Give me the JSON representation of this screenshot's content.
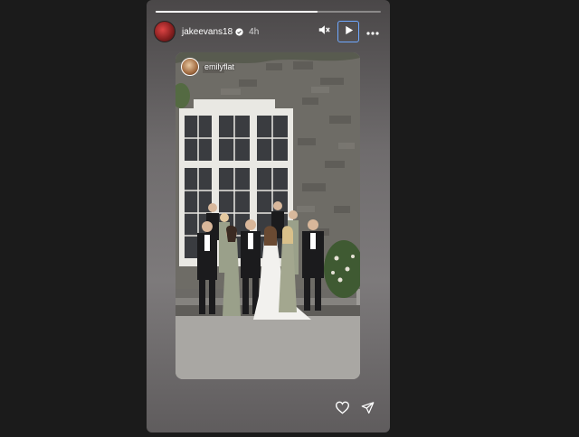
{
  "story": {
    "progress": 0.72,
    "author": {
      "username": "jakeevans18",
      "time": "4h",
      "verified": true
    },
    "controls": {
      "mute_icon": "speaker-muted-icon",
      "play_icon": "play-icon",
      "more_icon": "more-options-icon"
    },
    "embedded": {
      "username": "emilyflat"
    },
    "footer": {
      "like_icon": "heart-icon",
      "share_icon": "send-icon"
    }
  },
  "colors": {
    "background": "#1b1b1b",
    "accent": "#6fa8ff",
    "text": "#ffffff"
  }
}
